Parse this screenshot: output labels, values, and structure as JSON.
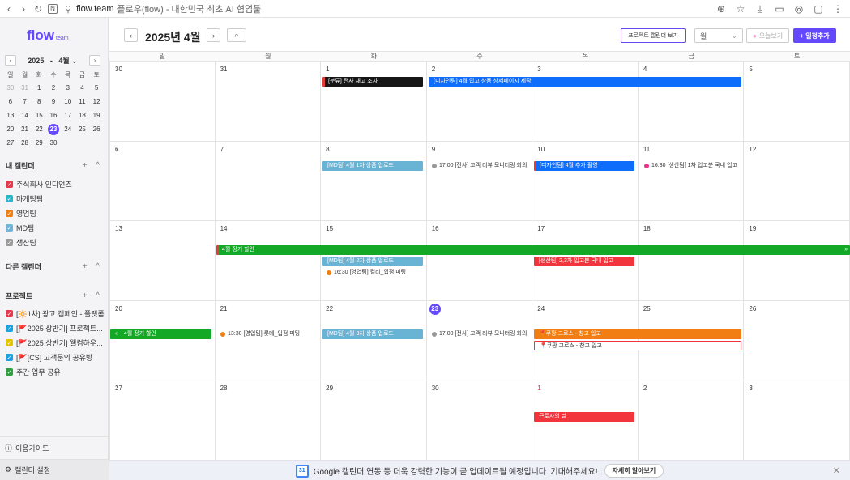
{
  "browser": {
    "domain": "flow.team",
    "page_title": "플로우(flow) - 대한민국 최초 AI 협업툴"
  },
  "logo": {
    "mark": "flow",
    "sub": "team"
  },
  "mini_cal": {
    "year": "2025",
    "sep": "-",
    "month": "4월 ⌄",
    "weekdays": [
      "일",
      "월",
      "화",
      "수",
      "목",
      "금",
      "토"
    ],
    "days": [
      {
        "n": "30",
        "dim": true
      },
      {
        "n": "31",
        "dim": true
      },
      {
        "n": "1"
      },
      {
        "n": "2"
      },
      {
        "n": "3"
      },
      {
        "n": "4"
      },
      {
        "n": "5"
      },
      {
        "n": "6"
      },
      {
        "n": "7"
      },
      {
        "n": "8"
      },
      {
        "n": "9"
      },
      {
        "n": "10"
      },
      {
        "n": "11"
      },
      {
        "n": "12"
      },
      {
        "n": "13"
      },
      {
        "n": "14"
      },
      {
        "n": "15"
      },
      {
        "n": "16"
      },
      {
        "n": "17"
      },
      {
        "n": "18"
      },
      {
        "n": "19"
      },
      {
        "n": "20"
      },
      {
        "n": "21"
      },
      {
        "n": "22"
      },
      {
        "n": "23",
        "today": true
      },
      {
        "n": "24"
      },
      {
        "n": "25"
      },
      {
        "n": "26"
      },
      {
        "n": "27"
      },
      {
        "n": "28"
      },
      {
        "n": "29"
      },
      {
        "n": "30"
      }
    ]
  },
  "sections": {
    "my": "내 캘린더",
    "other": "다른 캘린더",
    "project": "프로젝트",
    "ctrl": "+ ^"
  },
  "my_calendars": [
    {
      "label": "주식회사 인디언즈",
      "color": "#e8384f"
    },
    {
      "label": "마케팅팀",
      "color": "#2bb5c8"
    },
    {
      "label": "영업팀",
      "color": "#f07e12"
    },
    {
      "label": "MD팀",
      "color": "#6fb4d9"
    },
    {
      "label": "생산팀",
      "color": "#9a9a9a"
    }
  ],
  "projects": [
    {
      "label": "[🔆1차] 광고 캠페인 - 플랫폼",
      "color": "#e8384f"
    },
    {
      "label": "[🚩2025 상반기] 프로젝트...",
      "color": "#1da1e0"
    },
    {
      "label": "[🚩2025 상반기] 웰컴하우...",
      "color": "#e2c400"
    },
    {
      "label": "[🚩[CS] 고객문의 공유방",
      "color": "#1da1e0"
    },
    {
      "label": "주간 업무 공유",
      "color": "#2e9e3e"
    }
  ],
  "footer": {
    "guide": "이용가이드",
    "settings": "캘린더 설정"
  },
  "toolbar": {
    "title": "2025년 4월",
    "project_btn": "프로젝트 캘린더 보기",
    "view_select": "월",
    "today_btn": "오늘보기",
    "add_btn": "+ 일정추가"
  },
  "weekdays": [
    "일",
    "월",
    "화",
    "수",
    "목",
    "금",
    "토"
  ],
  "days": [
    "30",
    "31",
    "1",
    "2",
    "3",
    "4",
    "5",
    "6",
    "7",
    "8",
    "9",
    "10",
    "11",
    "12",
    "13",
    "14",
    "15",
    "16",
    "17",
    "18",
    "19",
    "20",
    "21",
    "22",
    "23",
    "24",
    "25",
    "26",
    "27",
    "28",
    "29",
    "30",
    "1",
    "2",
    "3"
  ],
  "events": {
    "e1": "[분류] 전사 재고 조사",
    "e2": "[디자인팀] 4월 입고 상품 상세페이지 제작",
    "e3": "[MD팀] 4월 1차 상품 업로드",
    "e4": "17:00 [전사] 고객 리뷰 모니터링 회의",
    "e5": "[디자인팀] 4월 추가 촬영",
    "e6": "16:30 [생산팀] 1차 입고분 국내 입고",
    "e7": "4월 정기 할인",
    "e8": "[MD팀] 4월 2차 상품 업로드",
    "e9": "16:30 [영업팀] 컬리_입점 미팅",
    "e10": "[생산팀] 2,3차 입고분 국내 입고",
    "e11": "4월 정기 할인",
    "e12": "13:30 [영업팀] 롯데_입점 미팅",
    "e13": "[MD팀] 4월 3차 상품 업로드",
    "e14": "17:00 [전사] 고객 리뷰 모니터링 회의",
    "e15": "쿠팡 그로스 - 창고 입고",
    "e16": "쿠팡 그로스 - 창고 입고",
    "e17": "근로자의 날"
  },
  "banner": {
    "icon": "31",
    "text": "Google 캘린더 연동 등 더욱 강력한 기능이 곧 업데이트될 예정입니다. 기대해주세요!",
    "btn": "자세히 알아보기"
  },
  "colors": {
    "accent": "#6449fc",
    "black": "#161616",
    "blue": "#0f6dfb",
    "lightblue": "#69b3d4",
    "green": "#13a826",
    "red": "#f2353d",
    "orange": "#f07e12"
  }
}
